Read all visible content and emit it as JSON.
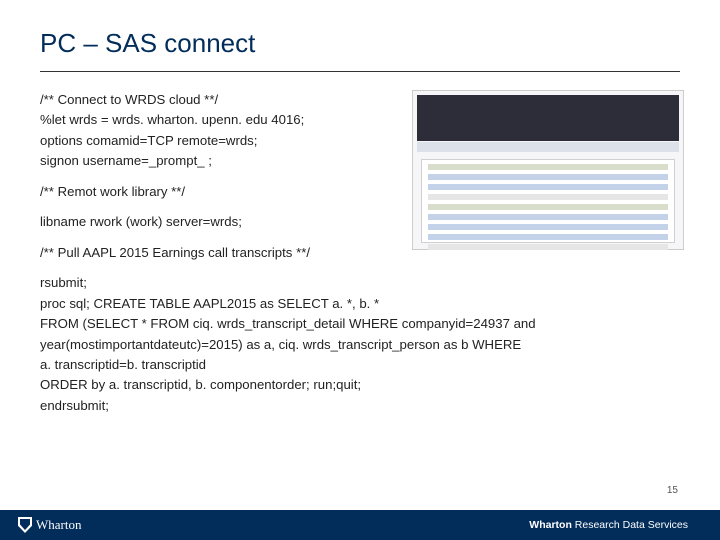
{
  "title": "PC – SAS connect",
  "code": {
    "c1": "/** Connect to WRDS cloud **/",
    "c2": "%let wrds = wrds. wharton. upenn. edu 4016;",
    "c3": "options comamid=TCP remote=wrds;",
    "c4": "signon username=_prompt_ ;",
    "c5": "/** Remot work library **/",
    "c6": "libname rwork (work) server=wrds;",
    "c7": "/** Pull AAPL 2015 Earnings call transcripts **/",
    "c8": "rsubmit;",
    "c9": "proc sql; CREATE TABLE AAPL2015 as SELECT a. *, b. *",
    "c10": "FROM (SELECT * FROM ciq. wrds_transcript_detail WHERE companyid=24937 and",
    "c11": "year(mostimportantdateutc)=2015)  as a, ciq. wrds_transcript_person as b WHERE",
    "c12": "a. transcriptid=b. transcriptid",
    "c13": "ORDER by a. transcriptid, b. componentorder; run;quit;",
    "c14": "endrsubmit;"
  },
  "page_number": "15",
  "footer": {
    "logo_text": "Wharton",
    "right_bold": "Wharton",
    "right_rest": " Research Data Services"
  }
}
